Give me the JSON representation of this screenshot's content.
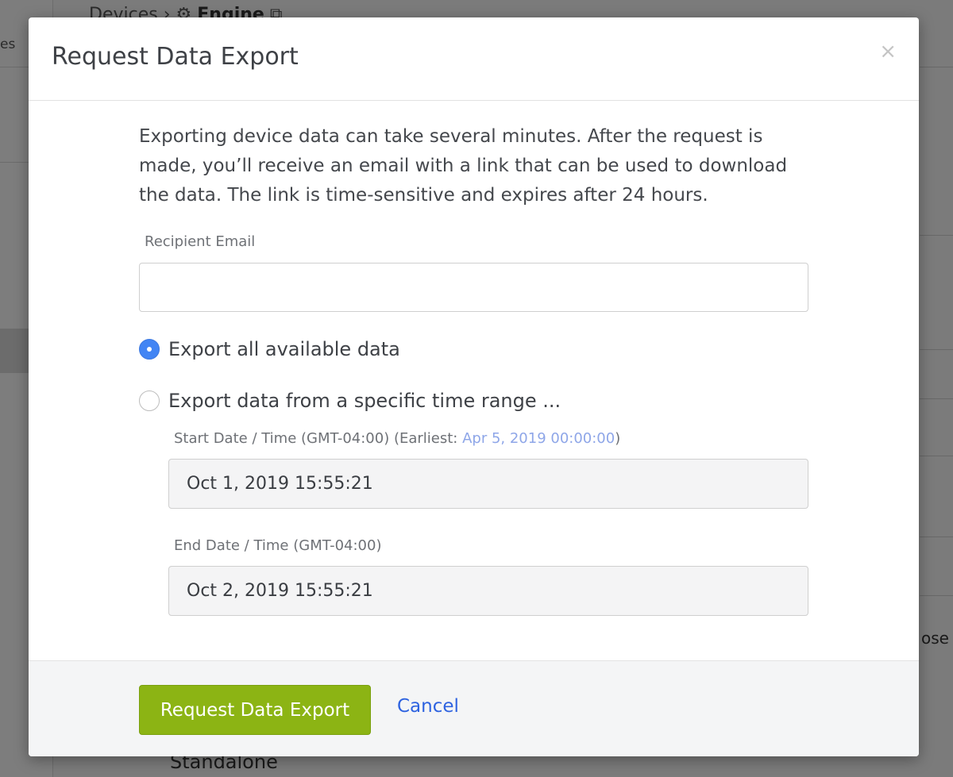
{
  "background": {
    "sidebar_text": "es",
    "breadcrumb_parent": "Devices",
    "breadcrumb_separator": "›",
    "breadcrumb_current": "Engine",
    "right_text": "ose",
    "bottom_text": "Standalone"
  },
  "modal": {
    "title": "Request Data Export",
    "close_glyph": "×",
    "description": "Exporting device data can take several minutes. After the request is made, you’ll receive an email with a link that can be used to download the data. The link is time-sensitive and expires after 24 hours.",
    "recipient": {
      "label": "Recipient Email",
      "value": "",
      "placeholder": ""
    },
    "options": [
      {
        "label": "Export all available data",
        "checked": true
      },
      {
        "label": "Export data from a specific time range ...",
        "checked": false
      }
    ],
    "start": {
      "label_prefix": "Start Date / Time (GMT-04:00) (Earliest: ",
      "earliest": "Apr 5, 2019 00:00:00",
      "label_suffix": ")",
      "value": "Oct 1, 2019 15:55:21"
    },
    "end": {
      "label": "End Date / Time (GMT-04:00)",
      "value": "Oct 2, 2019 15:55:21"
    },
    "submit_label": "Request Data Export",
    "cancel_label": "Cancel"
  },
  "colors": {
    "primary_button": "#8cb414",
    "link": "#2e63e0",
    "radio_checked": "#4285f4",
    "earliest_highlight": "#8ea6e8"
  }
}
